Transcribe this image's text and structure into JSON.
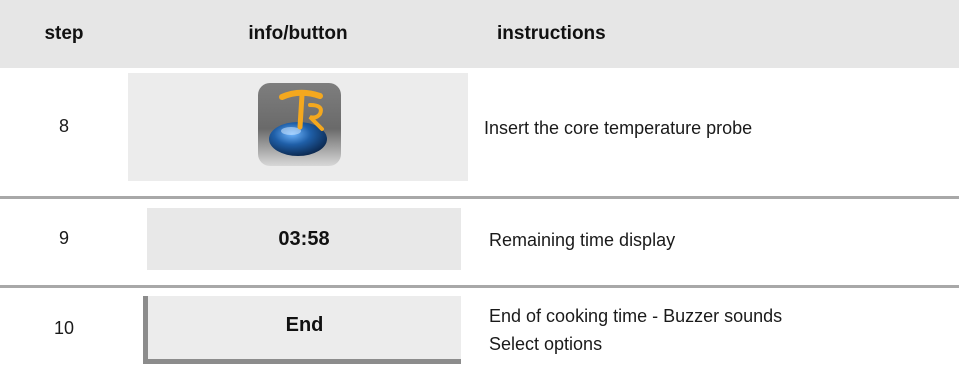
{
  "header": {
    "step": "step",
    "info": "info/button",
    "instructions": "instructions"
  },
  "rows": [
    {
      "step": "8",
      "icon": "core-temperature-probe-icon",
      "instruction": "Insert the core temperature probe"
    },
    {
      "step": "9",
      "time_display": "03:58",
      "instruction": "Remaining time display"
    },
    {
      "step": "10",
      "button_label": "End",
      "instruction_line1": "End of cooking time - Buzzer sounds",
      "instruction_line2": "Select options"
    }
  ],
  "colors": {
    "header_bg": "#e6e6e6",
    "panel_bg": "#ececec",
    "separator": "#a8a8a8",
    "icon_blue": "#1a4f8a",
    "icon_orange": "#f0a020"
  }
}
